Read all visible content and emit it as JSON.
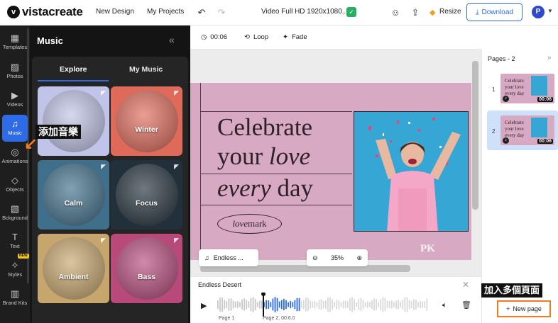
{
  "header": {
    "logo_text": "vistacreate",
    "logo_mark": "v",
    "nav": [
      "New Design",
      "My Projects"
    ],
    "doc_title": "Video Full HD 1920x1080...",
    "resize_label": "Resize",
    "download_label": "Download",
    "avatar_initial": "P"
  },
  "rail": {
    "items": [
      {
        "label": "Templates",
        "icon": "grid-icon",
        "glyph": "▦"
      },
      {
        "label": "Photos",
        "icon": "photo-icon",
        "glyph": "▨"
      },
      {
        "label": "Videos",
        "icon": "video-icon",
        "glyph": "▶"
      },
      {
        "label": "Music",
        "icon": "music-icon",
        "glyph": "♫"
      },
      {
        "label": "Animations",
        "icon": "animation-icon",
        "glyph": "◎"
      },
      {
        "label": "Objects",
        "icon": "objects-icon",
        "glyph": "◇"
      },
      {
        "label": "Bckground",
        "icon": "background-icon",
        "glyph": "▧"
      },
      {
        "label": "Text",
        "icon": "text-icon",
        "glyph": "T"
      },
      {
        "label": "Styles",
        "icon": "styles-icon",
        "glyph": "✧"
      },
      {
        "label": "Brand Kits",
        "icon": "brand-kit-icon",
        "glyph": "▥"
      }
    ],
    "new_badge": "NEW",
    "active_index": 3
  },
  "panel": {
    "title": "Music",
    "tabs": [
      "Explore",
      "My Music"
    ],
    "cards": [
      {
        "label": "",
        "bg": "#c0c4e8"
      },
      {
        "label": "Winter",
        "bg": "#e06a5a"
      },
      {
        "label": "Calm",
        "bg": "#3f6f8a"
      },
      {
        "label": "Focus",
        "bg": "#21303a"
      },
      {
        "label": "Ambient",
        "bg": "#c6a66c"
      },
      {
        "label": "Bass",
        "bg": "#b84a7a"
      }
    ]
  },
  "annotations": {
    "add_music": "添加音樂",
    "add_pages": "加入多個頁面"
  },
  "editor_toolbar": {
    "time": "00:06",
    "loop": "Loop",
    "fade": "Fade"
  },
  "slide": {
    "line1": "Celebrate",
    "line2_a": "your ",
    "line2_b": "love",
    "line3_a": "every",
    "line3_b": " day",
    "brand_a": "love",
    "brand_b": "mark",
    "watermark": "PK"
  },
  "canvas_controls": {
    "music_pill": "Endless ...",
    "zoom": "35%"
  },
  "track": {
    "title": "Endless Desert",
    "page_label": "Page 1",
    "marker_label": "Page 2, 00:6.0",
    "progress": 0.4
  },
  "pages": {
    "title": "Pages - 2",
    "items": [
      {
        "num": "1",
        "duration": "00:06"
      },
      {
        "num": "2",
        "duration": "00:06"
      }
    ],
    "thumb_lines": [
      "Celebrate",
      "your love",
      "every day"
    ],
    "new_page_label": "New page"
  },
  "colors": {
    "accent": "#2e6be6",
    "annotation": "#f07a20",
    "slide_bg": "#d7a9c2"
  }
}
